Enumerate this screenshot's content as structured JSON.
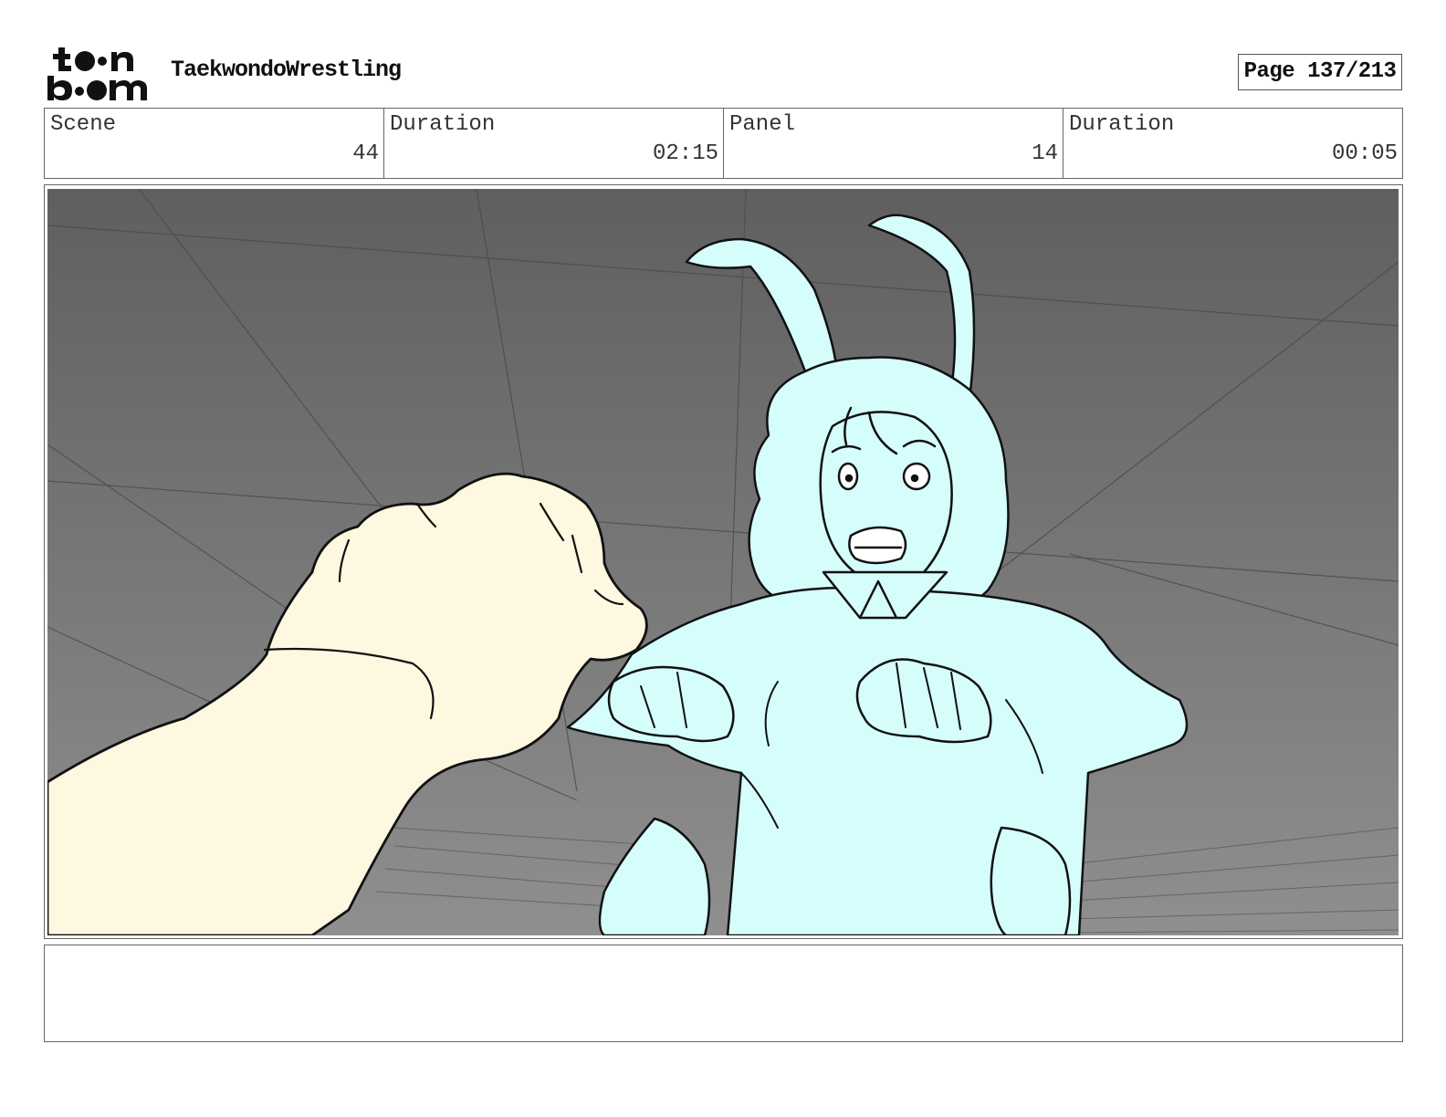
{
  "header": {
    "logo_text": "toon boom",
    "project_title": "TaekwondoWrestling",
    "page_label": "Page 137/213"
  },
  "info": {
    "scene_label": "Scene",
    "scene_value": "44",
    "scene_duration_label": "Duration",
    "scene_duration_value": "02:15",
    "panel_label": "Panel",
    "panel_value": "14",
    "panel_duration_label": "Duration",
    "panel_duration_value": "00:05"
  },
  "colors": {
    "background_top": "#5f5f5f",
    "background_bottom": "#8f8f8f",
    "fist_fill": "#fdf8df",
    "character_fill": "#d4fdfb",
    "line": "#111111"
  },
  "notes": {
    "text": ""
  }
}
